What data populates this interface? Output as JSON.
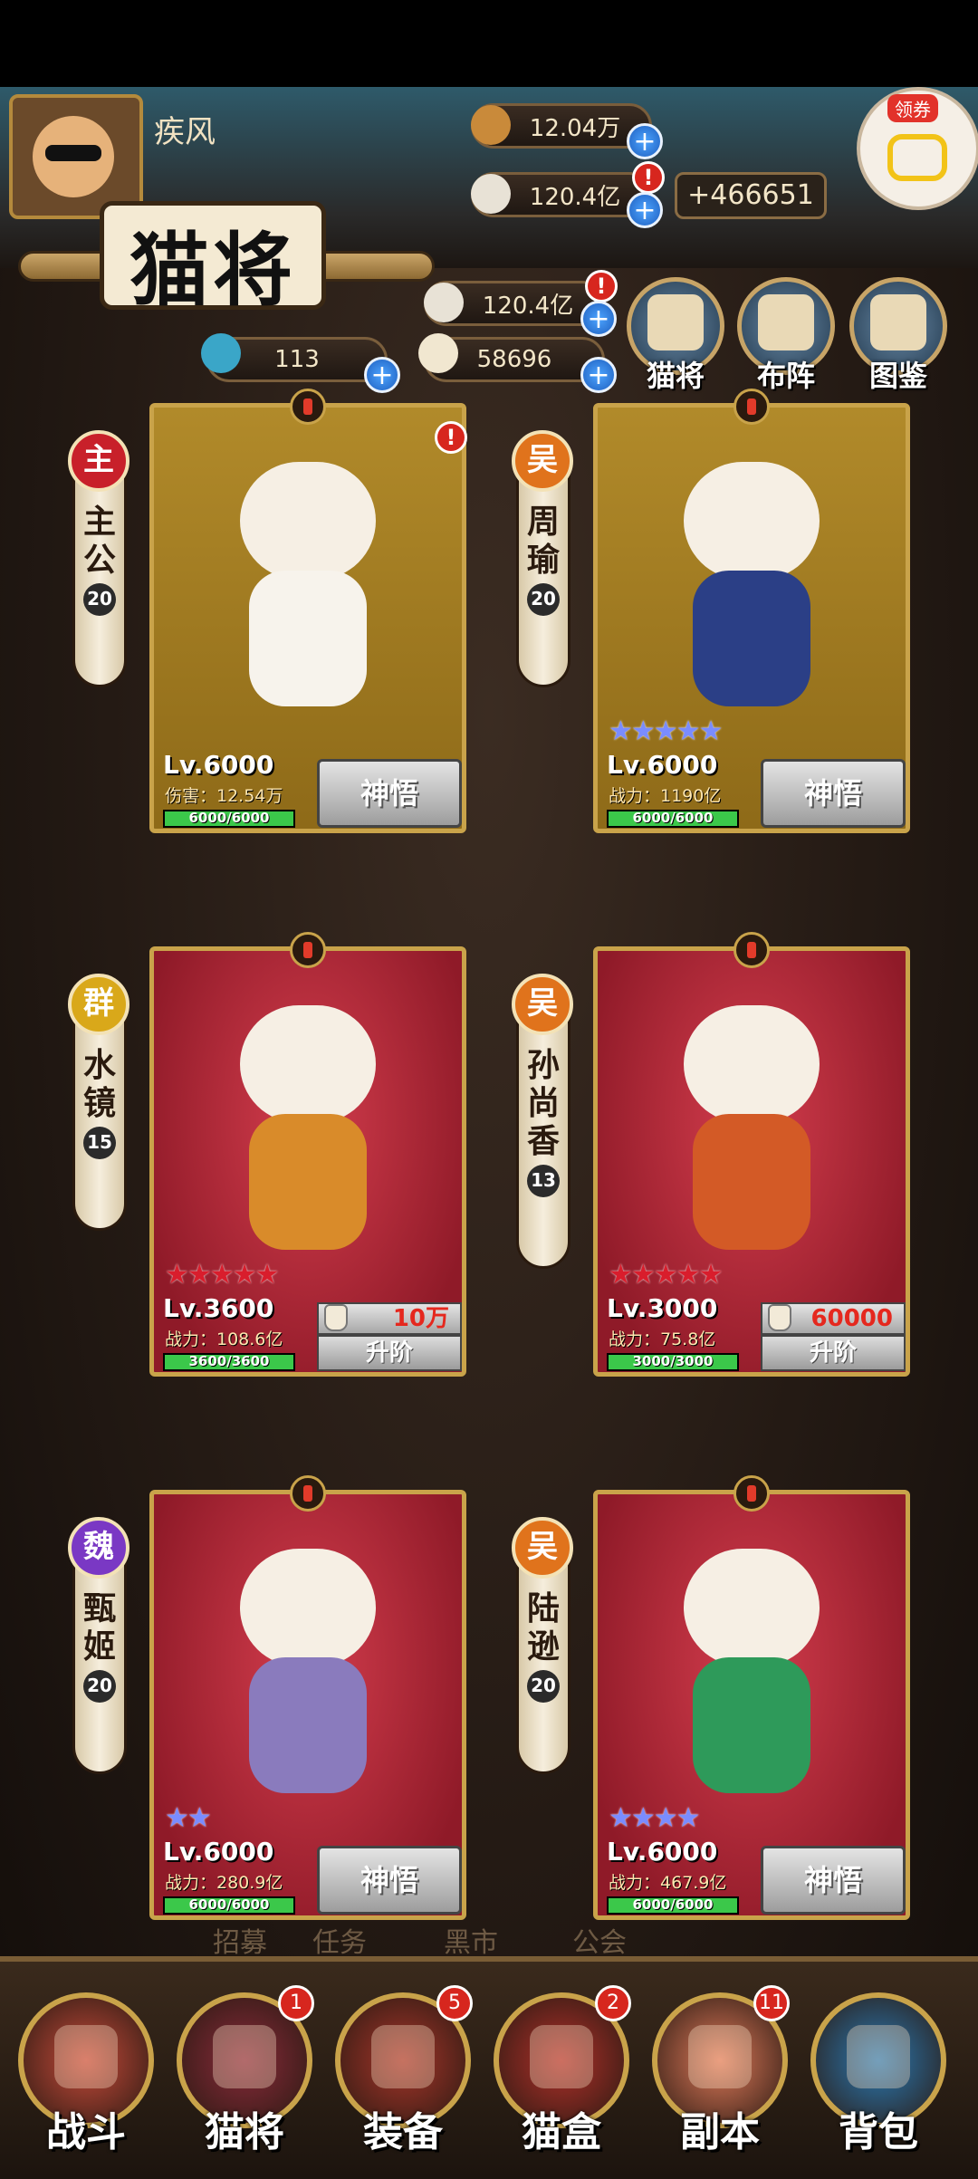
{
  "player": {
    "name": "疾风"
  },
  "resources": {
    "top1": "12.04万",
    "top2": "120.4亿",
    "gain": "+466651",
    "mid1": "120.4亿",
    "left1": "113",
    "left2": "58696",
    "alert": "!"
  },
  "coupon": {
    "label": "领券"
  },
  "page_title": "猫将",
  "top_buttons": [
    {
      "label": "猫将",
      "icon": "cat-face-icon"
    },
    {
      "label": "布阵",
      "icon": "formation-icon"
    },
    {
      "label": "图鉴",
      "icon": "scroll-icon"
    }
  ],
  "heroes": [
    {
      "faction": "主",
      "name_chars": [
        "主",
        "公"
      ],
      "level_tag": "20",
      "lv": "Lv.6000",
      "stat": "伤害：12.54万",
      "hp": "6000/6000",
      "hp_fraction": 1.0,
      "action": "神悟",
      "stars": 0,
      "card": "gold",
      "alert": "!"
    },
    {
      "faction": "吴",
      "name_chars": [
        "周",
        "瑜"
      ],
      "level_tag": "20",
      "lv": "Lv.6000",
      "stat": "战力：1190亿",
      "hp": "6000/6000",
      "hp_fraction": 1.0,
      "action": "神悟",
      "stars": 5,
      "card": "gold"
    },
    {
      "faction": "群",
      "name_chars": [
        "水",
        "镜"
      ],
      "level_tag": "15",
      "lv": "Lv.3600",
      "stat": "战力：108.6亿",
      "hp": "3600/3600",
      "hp_fraction": 1.0,
      "upgrade_cost": "10万",
      "action": "升阶",
      "stars": 5,
      "card": "red"
    },
    {
      "faction": "吴",
      "name_chars": [
        "孙",
        "尚",
        "香"
      ],
      "level_tag": "13",
      "lv": "Lv.3000",
      "stat": "战力：75.8亿",
      "hp": "3000/3000",
      "hp_fraction": 1.0,
      "upgrade_cost": "60000",
      "action": "升阶",
      "stars": 5,
      "card": "red"
    },
    {
      "faction": "魏",
      "name_chars": [
        "甄",
        "姬"
      ],
      "level_tag": "20",
      "lv": "Lv.6000",
      "stat": "战力：280.9亿",
      "hp": "6000/6000",
      "hp_fraction": 1.0,
      "action": "神悟",
      "stars": 2,
      "card": "red"
    },
    {
      "faction": "吴",
      "name_chars": [
        "陆",
        "逊"
      ],
      "level_tag": "20",
      "lv": "Lv.6000",
      "stat": "战力：467.9亿",
      "hp": "6000/6000",
      "hp_fraction": 1.0,
      "action": "神悟",
      "stars": 4,
      "card": "red"
    }
  ],
  "behind_text": [
    "招募",
    "任务",
    "黑市",
    "公会"
  ],
  "bottom_nav": [
    {
      "label": "战斗",
      "badge": ""
    },
    {
      "label": "猫将",
      "badge": "1"
    },
    {
      "label": "装备",
      "badge": "5"
    },
    {
      "label": "猫盒",
      "badge": "2"
    },
    {
      "label": "副本",
      "badge": "11"
    },
    {
      "label": "背包",
      "badge": ""
    }
  ],
  "colors": {
    "faction_shu_main": "#c8202a",
    "faction_wu": "#e0731c",
    "faction_qun": "#d9a81a",
    "faction_wei": "#7a38c4"
  }
}
